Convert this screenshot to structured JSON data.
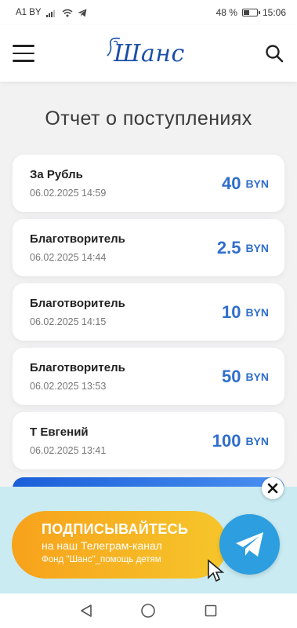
{
  "status_bar": {
    "carrier": "A1 BY",
    "battery_percent": "48 %",
    "battery_level": 0.48,
    "time": "15:06"
  },
  "header": {
    "logo_text": "Шанс",
    "menu_icon": "hamburger-menu-icon",
    "search_icon": "search-icon"
  },
  "page": {
    "title": "Отчет о поступлениях"
  },
  "donations": [
    {
      "name": "За Рубль",
      "date": "06.02.2025 14:59",
      "amount": "40",
      "currency": "BYN"
    },
    {
      "name": "Благотворитель",
      "date": "06.02.2025 14:44",
      "amount": "2.5",
      "currency": "BYN"
    },
    {
      "name": "Благотворитель",
      "date": "06.02.2025 14:15",
      "amount": "10",
      "currency": "BYN"
    },
    {
      "name": "Благотворитель",
      "date": "06.02.2025 13:53",
      "amount": "50",
      "currency": "BYN"
    },
    {
      "name": "Т Евгений",
      "date": "06.02.2025 13:41",
      "amount": "100",
      "currency": "BYN"
    }
  ],
  "banner": {
    "line1": "ПОДПИСЫВАЙТЕСЬ",
    "line2": "на наш Телеграм-канал",
    "line3": "Фонд \"Шанс\"_помощь детям",
    "close_icon": "close-icon",
    "telegram_icon": "telegram-icon"
  },
  "colors": {
    "accent": "#2f6ecb",
    "banner_bg": "#c9ebf1",
    "banner_pill": "#f7a21b",
    "telegram": "#2d9ee0"
  },
  "nav": {
    "back_icon": "back-triangle-icon",
    "home_icon": "home-circle-icon",
    "recents_icon": "recents-square-icon"
  }
}
